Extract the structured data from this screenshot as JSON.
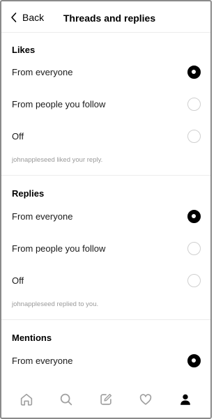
{
  "header": {
    "back_label": "Back",
    "title": "Threads and replies"
  },
  "sections": [
    {
      "title": "Likes",
      "options": [
        "From everyone",
        "From people you follow",
        "Off"
      ],
      "selected": 0,
      "caption": "johnappleseed liked your reply."
    },
    {
      "title": "Replies",
      "options": [
        "From everyone",
        "From people you follow",
        "Off"
      ],
      "selected": 0,
      "caption": "johnappleseed replied to you."
    },
    {
      "title": "Mentions",
      "options": [
        "From everyone"
      ],
      "selected": 0
    }
  ],
  "tabbar": {
    "items": [
      "home-icon",
      "search-icon",
      "compose-icon",
      "heart-icon",
      "profile-icon"
    ],
    "active": "profile-icon"
  },
  "colors": {
    "selected_radio": "#000000",
    "unselected_radio_border": "#cfcfcf",
    "caption_text": "#9a9a9a"
  }
}
